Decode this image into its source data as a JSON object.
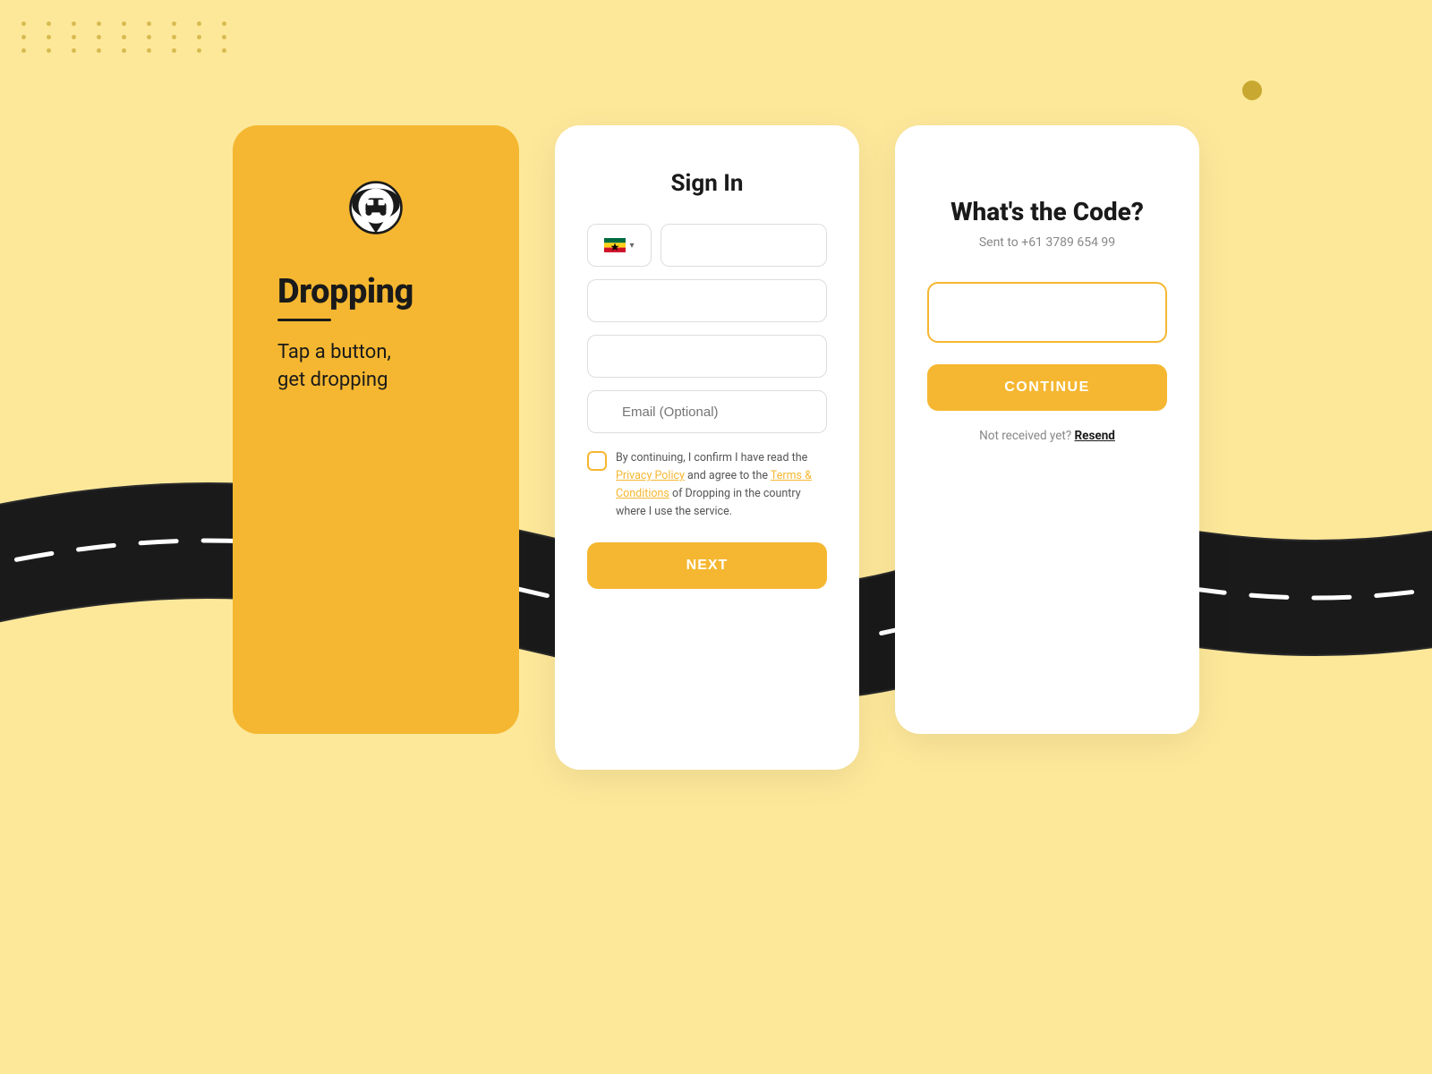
{
  "background": {
    "color": "#fde89a"
  },
  "decorative": {
    "dot_rows": 3,
    "dot_cols": 9
  },
  "card_intro": {
    "app_name": "Dropping",
    "tagline": "Tap a button,\nget dropping"
  },
  "card_signin": {
    "title": "Sign In",
    "phone_placeholder": "",
    "name_placeholder": "",
    "lastname_placeholder": "",
    "email_placeholder": "Email (Optional)",
    "flag_country": "GH",
    "terms_prefix": "By continuing, I confirm I have read the ",
    "privacy_policy_link": "Privacy Policy",
    "terms_middle": " and agree to the ",
    "terms_link": "Terms & Conditions",
    "terms_suffix": " of Dropping in the country where I use the service.",
    "next_button": "NEXT"
  },
  "card_code": {
    "title": "What's the Code?",
    "subtitle": "Sent to +61 3789 654 99",
    "code_input_value": "",
    "continue_button": "CONTINUE",
    "resend_prefix": "Not received yet?",
    "resend_link": "Resend"
  }
}
